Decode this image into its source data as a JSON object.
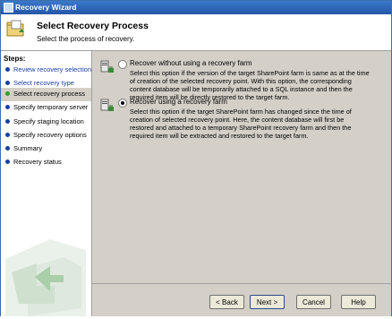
{
  "window": {
    "title": "Recovery Wizard"
  },
  "header": {
    "title": "Select Recovery Process",
    "subtitle": "Select the process of recovery."
  },
  "sidebar": {
    "title": "Steps:",
    "steps": [
      {
        "label": "Review recovery selection",
        "state": "done"
      },
      {
        "label": "Select recovery type",
        "state": "done"
      },
      {
        "label": "Select recovery process",
        "state": "active"
      },
      {
        "label": "Specify temporary server",
        "state": "pending"
      },
      {
        "label": "Specify staging location",
        "state": "pending"
      },
      {
        "label": "Specify recovery options",
        "state": "pending"
      },
      {
        "label": "Summary",
        "state": "pending"
      },
      {
        "label": "Recovery status",
        "state": "pending"
      }
    ]
  },
  "options": [
    {
      "label": "Recover without using a recovery farm",
      "checked": false,
      "description": "Select this option if the version of the target SharePoint farm is same as at the time of creation of the selected recovery point. With this option, the corresponding content database will be temporarily attached to a SQL instance and then the required item will be directly restored to the target farm."
    },
    {
      "label": "Recover using a recovery farm",
      "checked": true,
      "description": "Select this option if the target SharePoint farm has changed since the time of creation of selected recovery point. Here, the content database will first be restored and attached to a temporary SharePoint recovery farm and then the required item will be extracted and restored to the target farm."
    }
  ],
  "buttons": {
    "back": "< Back",
    "next": "Next >",
    "cancel": "Cancel",
    "help": "Help"
  },
  "colors": {
    "titlebar": "#2a5fb3",
    "step_link": "#1a3ea8",
    "active_dot": "#2f9e2f",
    "panel": "#d4d0c8"
  }
}
